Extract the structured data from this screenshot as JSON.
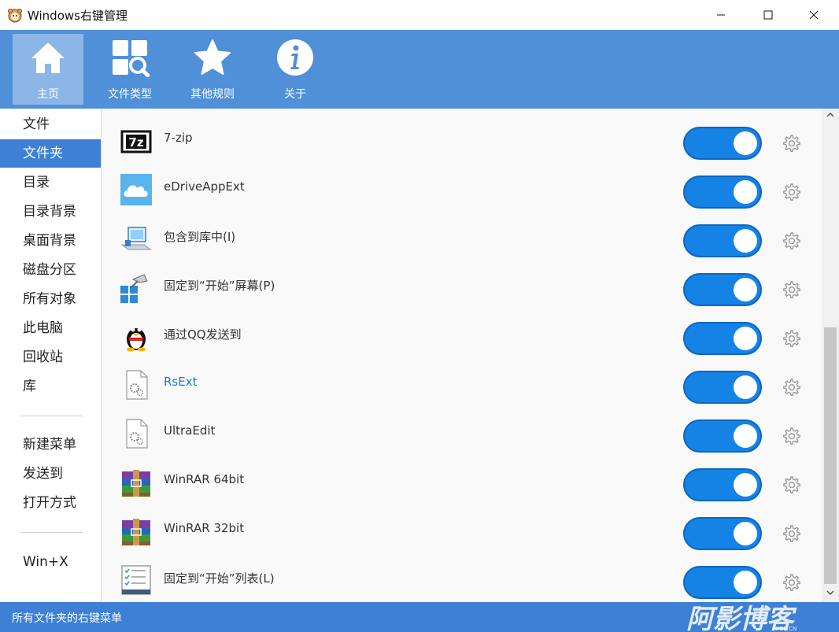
{
  "window": {
    "title": "Windows右键管理",
    "minimize": "—",
    "maximize": "☐",
    "close": "✕"
  },
  "toolbar": {
    "items": [
      {
        "label": "主页",
        "icon": "home-icon",
        "active": true
      },
      {
        "label": "文件类型",
        "icon": "file-types-icon",
        "active": false
      },
      {
        "label": "其他规则",
        "icon": "star-icon",
        "active": false
      },
      {
        "label": "关于",
        "icon": "info-icon",
        "active": false
      }
    ]
  },
  "sidebar": {
    "items": [
      {
        "label": "文件"
      },
      {
        "label": "文件夹"
      },
      {
        "label": "目录"
      },
      {
        "label": "目录背景"
      },
      {
        "label": "桌面背景"
      },
      {
        "label": "磁盘分区"
      },
      {
        "label": "所有对象"
      },
      {
        "label": "此电脑"
      },
      {
        "label": "回收站"
      },
      {
        "label": "库"
      },
      {
        "label": "新建菜单"
      },
      {
        "label": "发送到"
      },
      {
        "label": "打开方式"
      },
      {
        "label": "Win+X"
      }
    ],
    "active_index": 1
  },
  "list": {
    "rows": [
      {
        "label": "7-zip",
        "icon": "7zip-icon",
        "enabled": true
      },
      {
        "label": "eDriveAppExt",
        "icon": "cloud-icon",
        "enabled": true
      },
      {
        "label": "包含到库中(I)",
        "icon": "library-icon",
        "enabled": true
      },
      {
        "label": "固定到“开始”屏幕(P)",
        "icon": "pin-start-icon",
        "enabled": true
      },
      {
        "label": "通过QQ发送到",
        "icon": "qq-penguin-icon",
        "enabled": true
      },
      {
        "label": "RsExt",
        "icon": "settings-file-icon",
        "enabled": true,
        "highlight": true
      },
      {
        "label": "UltraEdit",
        "icon": "settings-file-icon",
        "enabled": true
      },
      {
        "label": "WinRAR 64bit",
        "icon": "winrar-icon",
        "enabled": true
      },
      {
        "label": "WinRAR 32bit",
        "icon": "winrar-icon",
        "enabled": true
      },
      {
        "label": "固定到“开始”列表(L)",
        "icon": "pin-list-icon",
        "enabled": true
      }
    ]
  },
  "statusbar": {
    "text": "所有文件夹的右键菜单",
    "watermark": "阿影博客",
    "watermark_sub": "AYBK.CN"
  },
  "colors": {
    "toolbar": "#4f90d8",
    "accent": "#3d80d6",
    "toggle_on": "#1582e6"
  }
}
